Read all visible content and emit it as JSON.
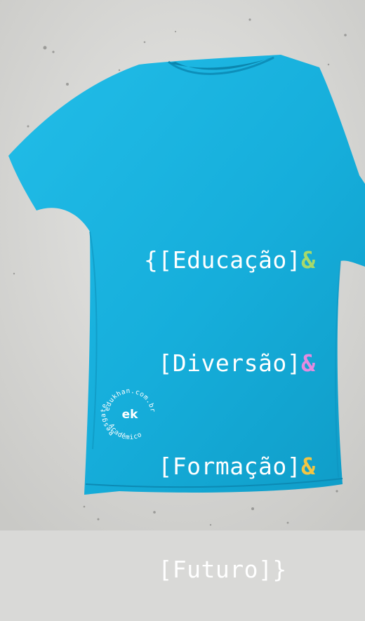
{
  "shirt": {
    "color": "#1ab0dc",
    "print": {
      "lines": [
        {
          "open": "{[",
          "word": "Educação",
          "close": "]",
          "amp": "&",
          "amp_color": "#a7d96b"
        },
        {
          "open": " [",
          "word": "Diversão",
          "close": "]",
          "amp": "&",
          "amp_color": "#e48be0"
        },
        {
          "open": " [",
          "word": "Formação",
          "close": "]",
          "amp": "&",
          "amp_color": "#f2c543"
        },
        {
          "open": " [",
          "word": "Futuro",
          "close": "]}",
          "amp": "",
          "amp_color": "#ffffff"
        }
      ]
    },
    "badge": {
      "logo": "ek",
      "ring_text_top": "edukhan.com.br",
      "ring_text_left": "Resgate",
      "ring_text_bottom": "Acadêmico"
    }
  },
  "background": {
    "color": "#d9d9d7"
  }
}
